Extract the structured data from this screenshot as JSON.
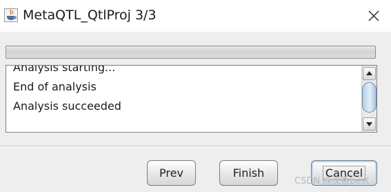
{
  "window": {
    "title": "MetaQTL_QtlProj 3/3",
    "app_icon": "java-cup-icon",
    "close_icon": "close-icon"
  },
  "progress": {
    "value": 0
  },
  "log": {
    "lines": [
      "Analysis starting...",
      "End of analysis",
      "Analysis succeeded"
    ]
  },
  "buttons": {
    "prev": "Prev",
    "finish": "Finish",
    "cancel": "Cancel"
  },
  "watermark": "CSDN @沈香best",
  "colors": {
    "title_bg": "#ffffff",
    "dialog_bg": "#eeeeee",
    "scroll_thumb": "#c9dcef"
  }
}
